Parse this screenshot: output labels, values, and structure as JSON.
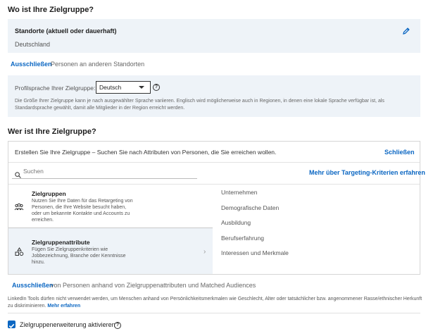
{
  "location_section": {
    "heading": "Wo ist Ihre Zielgruppe?",
    "box_title": "Standorte (aktuell oder dauerhaft)",
    "value": "Deutschland",
    "edit_icon": "pencil-icon",
    "exclude_label": "Ausschließen",
    "exclude_text": "Personen an anderen Standorten"
  },
  "language": {
    "label": "Profilsprache Ihrer Zielgruppe:",
    "selected": "Deutsch",
    "help_glyph": "?",
    "note": "Die Größe Ihrer Zielgruppe kann je nach ausgewählter Sprache variieren. Englisch wird möglicherweise auch in Regionen, in denen eine lokale Sprache verfügbar ist, als Standardsprache gewählt, damit alle Mitglieder in der Region erreicht werden."
  },
  "audience_section": {
    "heading": "Wer ist Ihre Zielgruppe?",
    "description": "Erstellen Sie Ihre Zielgruppe – Suchen Sie nach Attributen von Personen, die Sie erreichen wollen.",
    "close_label": "Schließen",
    "search_placeholder": "Suchen",
    "more_link": "Mehr über Targeting-Kriterien erfahren",
    "categories": [
      {
        "title": "Zielgruppen",
        "description": "Nutzen Sie Ihre Daten für das Retargeting von Personen, die Ihre Website besucht haben, oder um bekannte Kontakte und Accounts zu erreichen.",
        "icon": "people-group-icon"
      },
      {
        "title": "Zielgruppenattribute",
        "description": "Fügen Sie Zielgruppenkriterien wie Jobbezeichnung, Branche oder Kenntnisse hinzu.",
        "icon": "shapes-icon"
      }
    ],
    "chevron": "›",
    "attributes": [
      "Unternehmen",
      "Demografische Daten",
      "Ausbildung",
      "Berufserfahrung",
      "Interessen und Merkmale"
    ],
    "exclude_label": "Ausschließen",
    "exclude_text": "von Personen anhand von Zielgruppenattributen und Matched Audiences"
  },
  "policy": {
    "text": "LinkedIn Tools dürfen nicht verwendet werden, um Menschen anhand von Persönlichkeitsmerkmalen wie Geschlecht, Alter oder tatsächlicher bzw. angenommener Rasse/ethnischer Herkunft zu diskriminieren.",
    "link": "Mehr erfahren"
  },
  "expansion": {
    "label": "Zielgruppenerweiterung aktivieren",
    "checked": true,
    "help_glyph": "?"
  },
  "colors": {
    "accent": "#0a66c2",
    "panel_bg": "#eef3f8"
  }
}
